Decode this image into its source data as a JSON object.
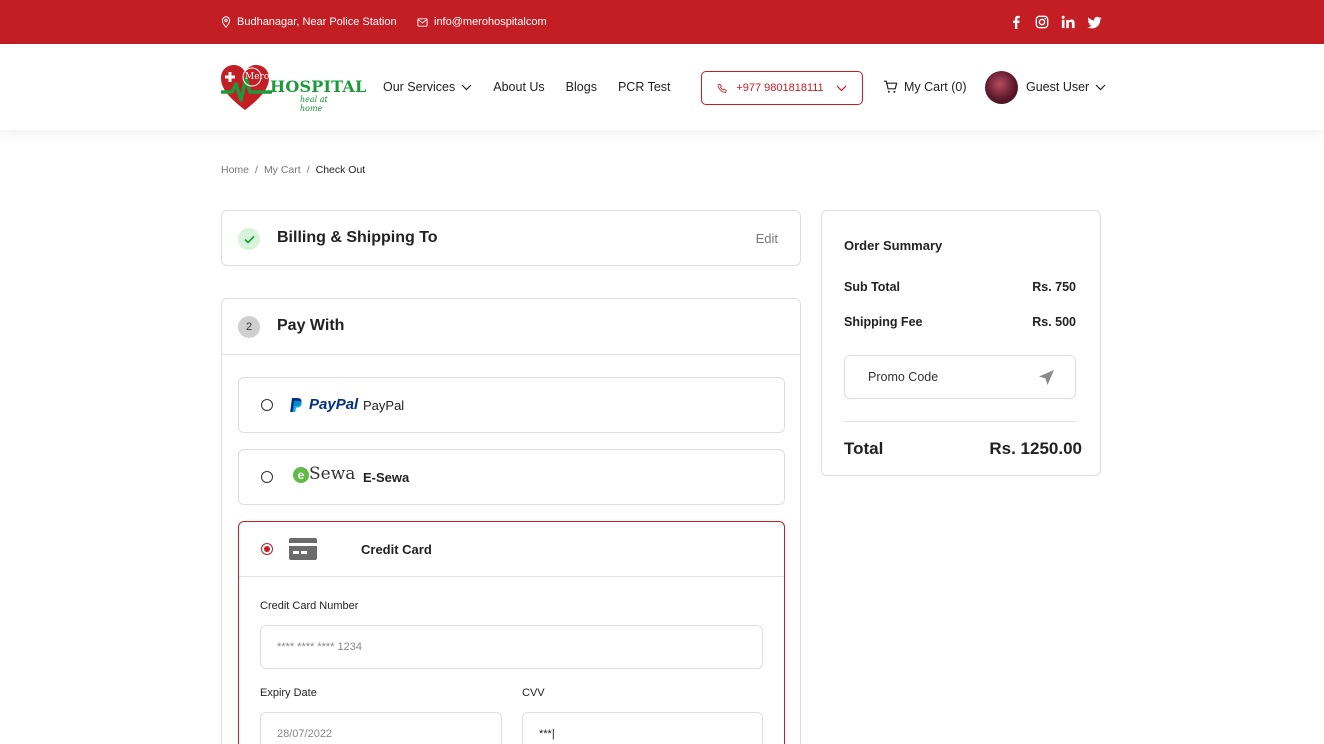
{
  "topbar": {
    "address": "Budhanagar, Near Police Station",
    "email": "info@merohospitalcom",
    "socials": [
      "facebook",
      "instagram",
      "linkedin",
      "twitter"
    ]
  },
  "header": {
    "logo_brand": "HOSPITAL",
    "logo_mark": "Mero",
    "logo_tagline": "heal at home",
    "nav": {
      "services": "Our Services",
      "about": "About Us",
      "blogs": "Blogs",
      "pcr": "PCR Test"
    },
    "phone": "+977 9801818111",
    "cart": "My Cart (0)",
    "user": "Guest User"
  },
  "breadcrumb": {
    "home": "Home",
    "cart": "My Cart",
    "current": "Check Out"
  },
  "billing": {
    "title": "Billing & Shipping To",
    "edit": "Edit"
  },
  "payment": {
    "step": "2",
    "title": "Pay With",
    "options": {
      "paypal_logo": "PayPal",
      "paypal": "PayPal",
      "esewa_logo": "Sewa",
      "esewa": "E-Sewa",
      "credit": "Credit Card"
    },
    "card_number_label": "Credit Card Number",
    "card_number_value": "**** **** **** 1234",
    "expiry_label": "Expiry Date",
    "expiry_value": "28/07/2022",
    "cvv_label": "CVV",
    "cvv_value": "***|"
  },
  "summary": {
    "title": "Order Summary",
    "subtotal_label": "Sub Total",
    "subtotal_value": "Rs. 750",
    "shipping_label": "Shipping Fee",
    "shipping_value": "Rs. 500",
    "promo_placeholder": "Promo Code",
    "total_label": "Total",
    "total_value": "Rs. 1250.00"
  },
  "colors": {
    "brand_red": "#c41e25",
    "brand_green": "#1b9a3b",
    "success_bg": "#d7f3d9"
  }
}
